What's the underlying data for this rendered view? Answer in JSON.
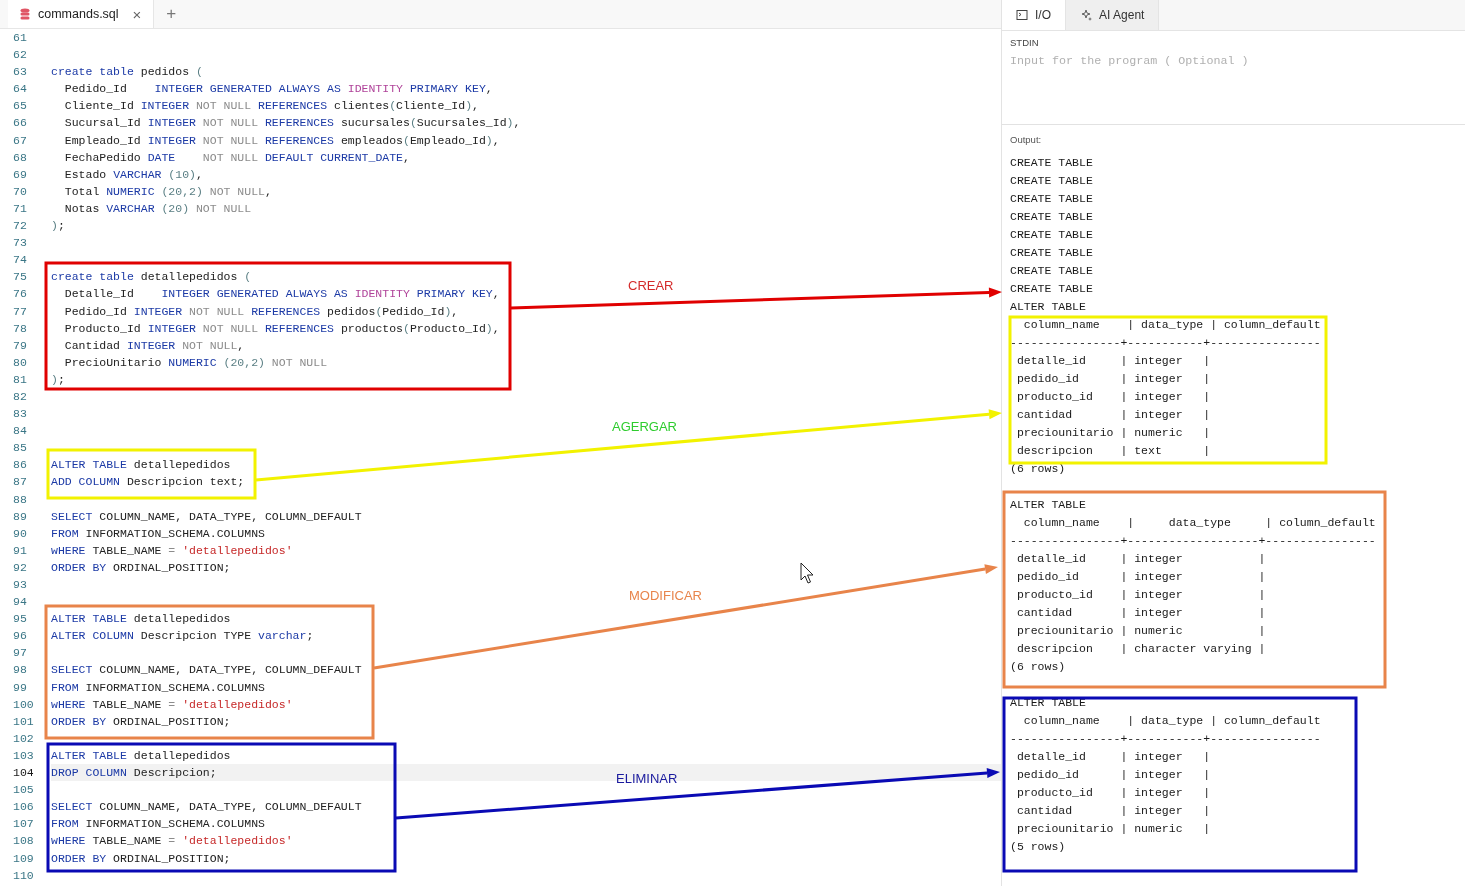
{
  "editor": {
    "tabs": [
      {
        "label": "commands.sql",
        "selected": true,
        "close": "×"
      }
    ],
    "new_tab": "+",
    "lines": [
      {
        "number": "61",
        "current": false
      },
      {
        "number": "62",
        "current": false
      },
      {
        "number": "63",
        "current": false,
        "tokens": [
          {
            "kind": "keyword",
            "text": "create table"
          },
          {
            "kind": "plain",
            "text": " pedidos "
          },
          {
            "kind": "paren",
            "text": "("
          }
        ]
      },
      {
        "number": "64",
        "current": false,
        "tokens": [
          {
            "kind": "plain",
            "text": "  Pedido_Id    "
          },
          {
            "kind": "keyword",
            "text": "INTEGER GENERATED ALWAYS AS "
          },
          {
            "kind": "special",
            "text": "IDENTITY"
          },
          {
            "kind": "keyword",
            "text": " PRIMARY KEY"
          },
          {
            "kind": "plain",
            "text": ","
          }
        ]
      },
      {
        "number": "65",
        "current": false,
        "tokens": [
          {
            "kind": "plain",
            "text": "  Cliente_Id "
          },
          {
            "kind": "keyword",
            "text": "INTEGER "
          },
          {
            "kind": "muted",
            "text": "NOT NULL "
          },
          {
            "kind": "keyword",
            "text": "REFERENCES "
          },
          {
            "kind": "plain",
            "text": "clientes"
          },
          {
            "kind": "paren",
            "text": "("
          },
          {
            "kind": "plain",
            "text": "Cliente_Id"
          },
          {
            "kind": "paren",
            "text": ")"
          },
          {
            "kind": "plain",
            "text": ","
          }
        ]
      },
      {
        "number": "66",
        "current": false,
        "tokens": [
          {
            "kind": "plain",
            "text": "  Sucursal_Id "
          },
          {
            "kind": "keyword",
            "text": "INTEGER "
          },
          {
            "kind": "muted",
            "text": "NOT NULL "
          },
          {
            "kind": "keyword",
            "text": "REFERENCES "
          },
          {
            "kind": "plain",
            "text": "sucursales"
          },
          {
            "kind": "paren",
            "text": "("
          },
          {
            "kind": "plain",
            "text": "Sucursales_Id"
          },
          {
            "kind": "paren",
            "text": ")"
          },
          {
            "kind": "plain",
            "text": ","
          }
        ]
      },
      {
        "number": "67",
        "current": false,
        "tokens": [
          {
            "kind": "plain",
            "text": "  Empleado_Id "
          },
          {
            "kind": "keyword",
            "text": "INTEGER "
          },
          {
            "kind": "muted",
            "text": "NOT NULL "
          },
          {
            "kind": "keyword",
            "text": "REFERENCES "
          },
          {
            "kind": "plain",
            "text": "empleados"
          },
          {
            "kind": "paren",
            "text": "("
          },
          {
            "kind": "plain",
            "text": "Empleado_Id"
          },
          {
            "kind": "paren",
            "text": ")"
          },
          {
            "kind": "plain",
            "text": ","
          }
        ]
      },
      {
        "number": "68",
        "current": false,
        "tokens": [
          {
            "kind": "plain",
            "text": "  FechaPedido "
          },
          {
            "kind": "keyword",
            "text": "DATE    "
          },
          {
            "kind": "muted",
            "text": "NOT NULL "
          },
          {
            "kind": "keyword",
            "text": "DEFAULT CURRENT_DATE"
          },
          {
            "kind": "plain",
            "text": ","
          }
        ]
      },
      {
        "number": "69",
        "current": false,
        "tokens": [
          {
            "kind": "plain",
            "text": "  Estado "
          },
          {
            "kind": "keyword",
            "text": "VARCHAR "
          },
          {
            "kind": "paren",
            "text": "(10)"
          },
          {
            "kind": "plain",
            "text": ","
          }
        ]
      },
      {
        "number": "70",
        "current": false,
        "tokens": [
          {
            "kind": "plain",
            "text": "  Total "
          },
          {
            "kind": "keyword",
            "text": "NUMERIC "
          },
          {
            "kind": "paren",
            "text": "(20,2) "
          },
          {
            "kind": "muted",
            "text": "NOT NULL"
          },
          {
            "kind": "plain",
            "text": ","
          }
        ]
      },
      {
        "number": "71",
        "current": false,
        "tokens": [
          {
            "kind": "plain",
            "text": "  Notas "
          },
          {
            "kind": "keyword",
            "text": "VARCHAR "
          },
          {
            "kind": "paren",
            "text": "(20) "
          },
          {
            "kind": "muted",
            "text": "NOT NULL"
          }
        ]
      },
      {
        "number": "72",
        "current": false,
        "tokens": [
          {
            "kind": "paren",
            "text": ")"
          },
          {
            "kind": "plain",
            "text": ";"
          }
        ]
      },
      {
        "number": "73",
        "current": false
      },
      {
        "number": "74",
        "current": false
      },
      {
        "number": "75",
        "current": false,
        "tokens": [
          {
            "kind": "keyword",
            "text": "create table"
          },
          {
            "kind": "plain",
            "text": " detallepedidos "
          },
          {
            "kind": "paren",
            "text": "("
          }
        ]
      },
      {
        "number": "76",
        "current": false,
        "tokens": [
          {
            "kind": "plain",
            "text": "  Detalle_Id    "
          },
          {
            "kind": "keyword",
            "text": "INTEGER GENERATED ALWAYS AS "
          },
          {
            "kind": "special",
            "text": "IDENTITY"
          },
          {
            "kind": "keyword",
            "text": " PRIMARY KEY"
          },
          {
            "kind": "plain",
            "text": ","
          }
        ]
      },
      {
        "number": "77",
        "current": false,
        "tokens": [
          {
            "kind": "plain",
            "text": "  Pedido_Id "
          },
          {
            "kind": "keyword",
            "text": "INTEGER "
          },
          {
            "kind": "muted",
            "text": "NOT NULL "
          },
          {
            "kind": "keyword",
            "text": "REFERENCES "
          },
          {
            "kind": "plain",
            "text": "pedidos"
          },
          {
            "kind": "paren",
            "text": "("
          },
          {
            "kind": "plain",
            "text": "Pedido_Id"
          },
          {
            "kind": "paren",
            "text": ")"
          },
          {
            "kind": "plain",
            "text": ","
          }
        ]
      },
      {
        "number": "78",
        "current": false,
        "tokens": [
          {
            "kind": "plain",
            "text": "  Producto_Id "
          },
          {
            "kind": "keyword",
            "text": "INTEGER "
          },
          {
            "kind": "muted",
            "text": "NOT NULL "
          },
          {
            "kind": "keyword",
            "text": "REFERENCES "
          },
          {
            "kind": "plain",
            "text": "productos"
          },
          {
            "kind": "paren",
            "text": "("
          },
          {
            "kind": "plain",
            "text": "Producto_Id"
          },
          {
            "kind": "paren",
            "text": ")"
          },
          {
            "kind": "plain",
            "text": ","
          }
        ]
      },
      {
        "number": "79",
        "current": false,
        "tokens": [
          {
            "kind": "plain",
            "text": "  Cantidad "
          },
          {
            "kind": "keyword",
            "text": "INTEGER "
          },
          {
            "kind": "muted",
            "text": "NOT NULL"
          },
          {
            "kind": "plain",
            "text": ","
          }
        ]
      },
      {
        "number": "80",
        "current": false,
        "tokens": [
          {
            "kind": "plain",
            "text": "  PrecioUnitario "
          },
          {
            "kind": "keyword",
            "text": "NUMERIC "
          },
          {
            "kind": "paren",
            "text": "(20,2) "
          },
          {
            "kind": "muted",
            "text": "NOT NULL"
          }
        ]
      },
      {
        "number": "81",
        "current": false,
        "tokens": [
          {
            "kind": "paren",
            "text": ")"
          },
          {
            "kind": "plain",
            "text": ";"
          }
        ]
      },
      {
        "number": "82",
        "current": false
      },
      {
        "number": "83",
        "current": false
      },
      {
        "number": "84",
        "current": false
      },
      {
        "number": "85",
        "current": false
      },
      {
        "number": "86",
        "current": false,
        "tokens": [
          {
            "kind": "keyword",
            "text": "ALTER TABLE"
          },
          {
            "kind": "plain",
            "text": " detallepedidos"
          }
        ]
      },
      {
        "number": "87",
        "current": false,
        "tokens": [
          {
            "kind": "keyword",
            "text": "ADD COLUMN"
          },
          {
            "kind": "plain",
            "text": " Descripcion text;"
          }
        ]
      },
      {
        "number": "88",
        "current": false
      },
      {
        "number": "89",
        "current": false,
        "tokens": [
          {
            "kind": "keyword",
            "text": "SELECT"
          },
          {
            "kind": "plain",
            "text": " COLUMN_NAME, DATA_TYPE, COLUMN_DEFAULT"
          }
        ]
      },
      {
        "number": "90",
        "current": false,
        "tokens": [
          {
            "kind": "keyword",
            "text": "FROM"
          },
          {
            "kind": "plain",
            "text": " INFORMATION_SCHEMA.COLUMNS"
          }
        ]
      },
      {
        "number": "91",
        "current": false,
        "tokens": [
          {
            "kind": "keyword",
            "text": "wHERE"
          },
          {
            "kind": "plain",
            "text": " TABLE_NAME "
          },
          {
            "kind": "muted",
            "text": "= "
          },
          {
            "kind": "string",
            "text": "'detallepedidos'"
          }
        ]
      },
      {
        "number": "92",
        "current": false,
        "tokens": [
          {
            "kind": "keyword",
            "text": "ORDER BY"
          },
          {
            "kind": "plain",
            "text": " ORDINAL_POSITION;"
          }
        ]
      },
      {
        "number": "93",
        "current": false
      },
      {
        "number": "94",
        "current": false
      },
      {
        "number": "95",
        "current": false,
        "tokens": [
          {
            "kind": "keyword",
            "text": "ALTER TABLE"
          },
          {
            "kind": "plain",
            "text": " detallepedidos"
          }
        ]
      },
      {
        "number": "96",
        "current": false,
        "tokens": [
          {
            "kind": "keyword",
            "text": "ALTER COLUMN"
          },
          {
            "kind": "plain",
            "text": " Descripcion TYPE "
          },
          {
            "kind": "keyword",
            "text": "varchar"
          },
          {
            "kind": "plain",
            "text": ";"
          }
        ]
      },
      {
        "number": "97",
        "current": false
      },
      {
        "number": "98",
        "current": false,
        "tokens": [
          {
            "kind": "keyword",
            "text": "SELECT"
          },
          {
            "kind": "plain",
            "text": " COLUMN_NAME, DATA_TYPE, COLUMN_DEFAULT"
          }
        ]
      },
      {
        "number": "99",
        "current": false,
        "tokens": [
          {
            "kind": "keyword",
            "text": "FROM"
          },
          {
            "kind": "plain",
            "text": " INFORMATION_SCHEMA.COLUMNS"
          }
        ]
      },
      {
        "number": "100",
        "current": false,
        "tokens": [
          {
            "kind": "keyword",
            "text": "wHERE"
          },
          {
            "kind": "plain",
            "text": " TABLE_NAME "
          },
          {
            "kind": "muted",
            "text": "= "
          },
          {
            "kind": "string",
            "text": "'detallepedidos'"
          }
        ]
      },
      {
        "number": "101",
        "current": false,
        "tokens": [
          {
            "kind": "keyword",
            "text": "ORDER BY"
          },
          {
            "kind": "plain",
            "text": " ORDINAL_POSITION;"
          }
        ]
      },
      {
        "number": "102",
        "current": false
      },
      {
        "number": "103",
        "current": false,
        "tokens": [
          {
            "kind": "keyword",
            "text": "ALTER TABLE"
          },
          {
            "kind": "plain",
            "text": " detallepedidos"
          }
        ]
      },
      {
        "number": "104",
        "current": true,
        "tokens": [
          {
            "kind": "keyword",
            "text": "DROP COLUMN"
          },
          {
            "kind": "plain",
            "text": " Descripcion;"
          }
        ]
      },
      {
        "number": "105",
        "current": false
      },
      {
        "number": "106",
        "current": false,
        "tokens": [
          {
            "kind": "keyword",
            "text": "SELECT"
          },
          {
            "kind": "plain",
            "text": " COLUMN_NAME, DATA_TYPE, COLUMN_DEFAULT"
          }
        ]
      },
      {
        "number": "107",
        "current": false,
        "tokens": [
          {
            "kind": "keyword",
            "text": "FROM"
          },
          {
            "kind": "plain",
            "text": " INFORMATION_SCHEMA.COLUMNS"
          }
        ]
      },
      {
        "number": "108",
        "current": false,
        "tokens": [
          {
            "kind": "keyword",
            "text": "wHERE"
          },
          {
            "kind": "plain",
            "text": " TABLE_NAME "
          },
          {
            "kind": "muted",
            "text": "= "
          },
          {
            "kind": "string",
            "text": "'detallepedidos'"
          }
        ]
      },
      {
        "number": "109",
        "current": false,
        "tokens": [
          {
            "kind": "keyword",
            "text": "ORDER BY"
          },
          {
            "kind": "plain",
            "text": " ORDINAL_POSITION;"
          }
        ]
      },
      {
        "number": "110",
        "current": false
      }
    ]
  },
  "io_panel": {
    "tabs": [
      {
        "label": "I/O",
        "selected": true
      },
      {
        "label": "AI Agent",
        "selected": false
      }
    ],
    "stdin": {
      "label": "STDIN",
      "placeholder": "Input for the program ( Optional )"
    },
    "output_label": "Output:",
    "output_blocks": [
      {
        "lines": [
          "CREATE TABLE",
          "CREATE TABLE",
          "CREATE TABLE",
          "CREATE TABLE",
          "CREATE TABLE",
          "CREATE TABLE",
          "CREATE TABLE",
          "CREATE TABLE",
          "ALTER TABLE",
          "  column_name    | data_type | column_default",
          "----------------+-----------+----------------",
          " detalle_id     | integer   |",
          " pedido_id      | integer   |",
          " producto_id    | integer   |",
          " cantidad       | integer   |",
          " preciounitario | numeric   |",
          " descripcion    | text      |",
          "(6 rows)"
        ]
      },
      {
        "lines": [
          "ALTER TABLE",
          "  column_name    |     data_type     | column_default",
          "----------------+-------------------+----------------",
          " detalle_id     | integer           |",
          " pedido_id      | integer           |",
          " producto_id    | integer           |",
          " cantidad       | integer           |",
          " preciounitario | numeric           |",
          " descripcion    | character varying |",
          "(6 rows)"
        ]
      },
      {
        "lines": [
          "ALTER TABLE",
          "  column_name    | data_type | column_default",
          "----------------+-----------+----------------",
          " detalle_id     | integer   |",
          " pedido_id      | integer   |",
          " producto_id    | integer   |",
          " cantidad       | integer   |",
          " preciounitario | numeric   |",
          "(5 rows)"
        ]
      }
    ]
  },
  "annotations": [
    {
      "color": "#e00000",
      "label": {
        "text": "CREAR",
        "color": "#d42a2a"
      }
    },
    {
      "color": "#f2f200",
      "label": {
        "text": "AGERGAR",
        "color": "#2ecc2e"
      }
    },
    {
      "color": "#e8844a",
      "label": {
        "text": "MODIFICAR",
        "color": "#e8844b"
      }
    },
    {
      "color": "#0a0ab4",
      "label": {
        "text": "ELIMINAR",
        "color": "#1a1a9e"
      }
    }
  ]
}
